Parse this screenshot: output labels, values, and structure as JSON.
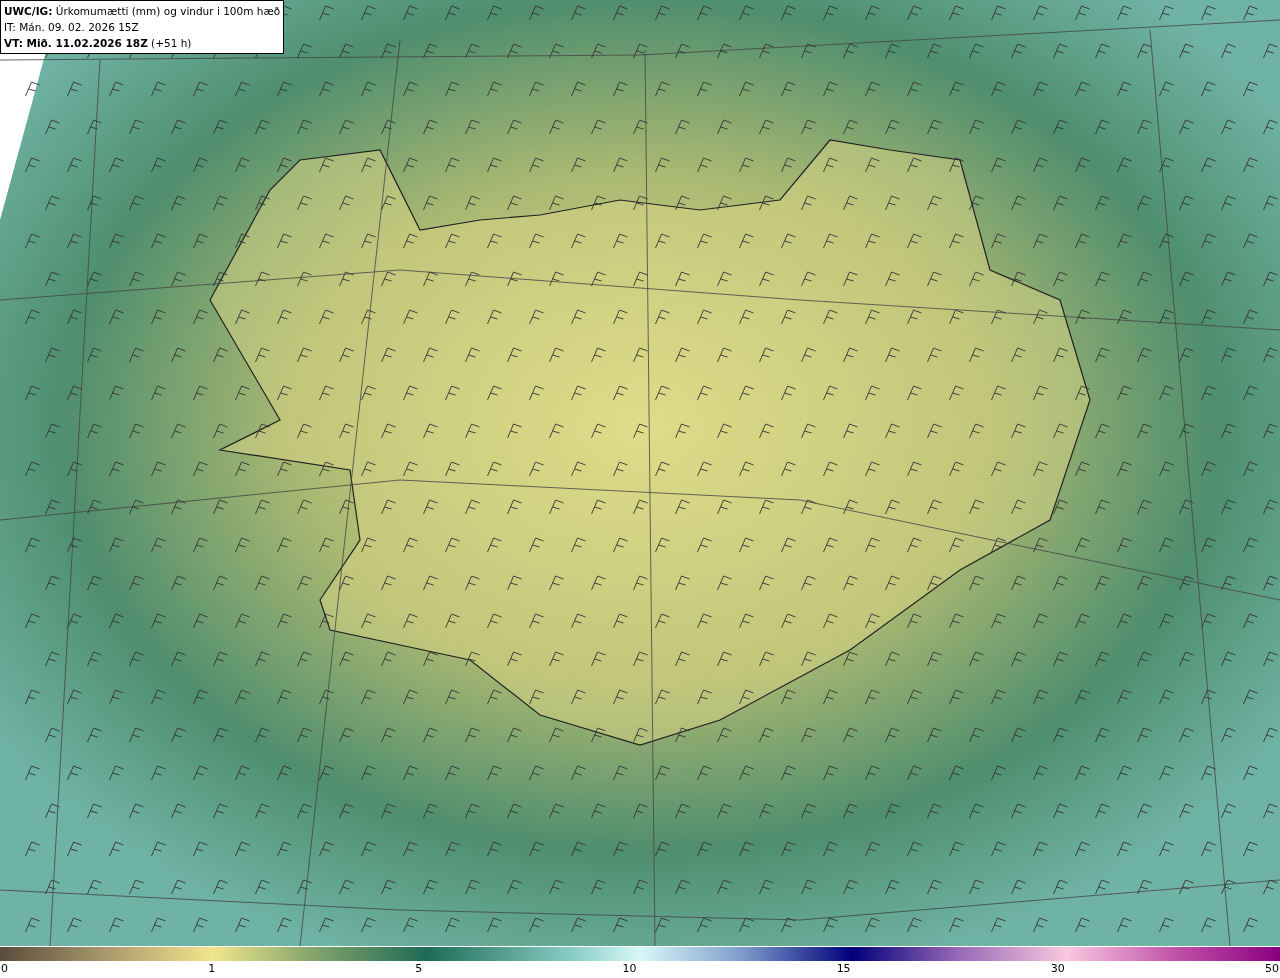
{
  "header": {
    "lines": [
      "**UWC/IG:** Úrkomumætti (mm) og vindur i 100m hæð",
      "IT: Mán. 09. 02. 2026 15Z",
      "**VT: Mið. 11.02.2026 18Z** (+51 h)"
    ]
  },
  "color_scale": {
    "labels": [
      "0",
      "1",
      "5",
      "10",
      "15",
      "30",
      "50"
    ]
  }
}
